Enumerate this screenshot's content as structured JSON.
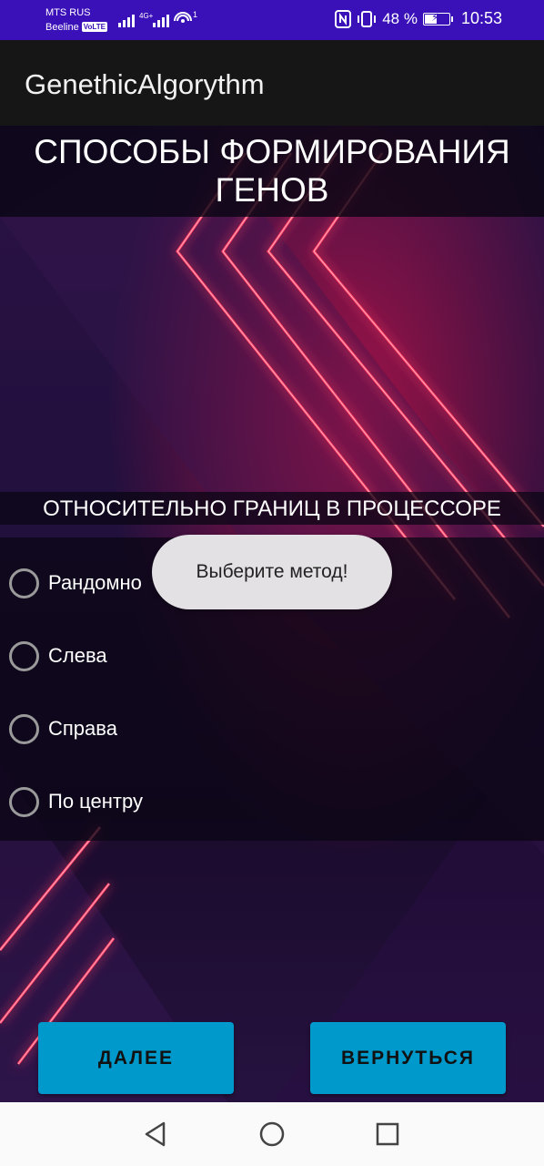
{
  "status_bar": {
    "carrier_1": "MTS RUS",
    "carrier_2": "Beeline",
    "volte_badge": "VoLTE",
    "network_type": "4G+",
    "sim_index": "1",
    "battery_percent": "48 %",
    "battery_level": 0.48,
    "time": "10:53",
    "icons": [
      "signal-icon",
      "wifi-hotspot-icon",
      "nfc-icon",
      "vibrate-icon",
      "battery-icon"
    ]
  },
  "app_bar": {
    "title": "GenethicAlgorythm"
  },
  "screen": {
    "title": "СПОСОБЫ ФОРМИРОВАНИЯ ГЕНОВ",
    "subtitle": "ОТНОСИТЕЛЬНО ГРАНИЦ В ПРОЦЕССОРЕ"
  },
  "options": [
    {
      "label": "Рандомно",
      "checked": false
    },
    {
      "label": "Слева",
      "checked": false
    },
    {
      "label": "Справа",
      "checked": false
    },
    {
      "label": "По центру",
      "checked": false
    }
  ],
  "toast": {
    "message": "Выберите метод!"
  },
  "buttons": {
    "next": "ДАЛЕЕ",
    "back": "ВЕРНУТЬСЯ"
  },
  "nav_bar": {
    "icons": [
      "back-triangle-icon",
      "home-circle-icon",
      "recents-square-icon"
    ]
  },
  "colors": {
    "status_bar": "#3a10b8",
    "app_bar": "#161616",
    "button": "#0099cc",
    "neon": "#ff2a55"
  }
}
